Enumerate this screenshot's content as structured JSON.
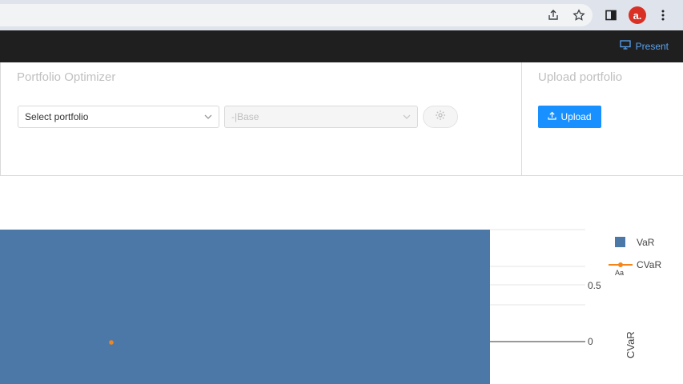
{
  "header": {
    "present_label": "Present",
    "avatar_letter": "a."
  },
  "optimizer": {
    "title": "Portfolio Optimizer",
    "portfolio_select": "Select portfolio",
    "base_select": "-|Base"
  },
  "upload": {
    "title": "Upload portfolio",
    "button_label": "Upload"
  },
  "colors": {
    "var_bar": "#4c78a8",
    "cvar_line": "#f58518",
    "upload_button": "#1890ff"
  },
  "chart_data": {
    "type": "bar",
    "series": [
      {
        "name": "VaR",
        "kind": "bar"
      },
      {
        "name": "CVaR",
        "kind": "line+marker"
      }
    ],
    "y_axis": {
      "title": "CVaR",
      "side": "right",
      "ticks": [
        "0.5",
        "0"
      ]
    },
    "legend": {
      "placement": "top-right",
      "extra_label": "Aa"
    }
  }
}
